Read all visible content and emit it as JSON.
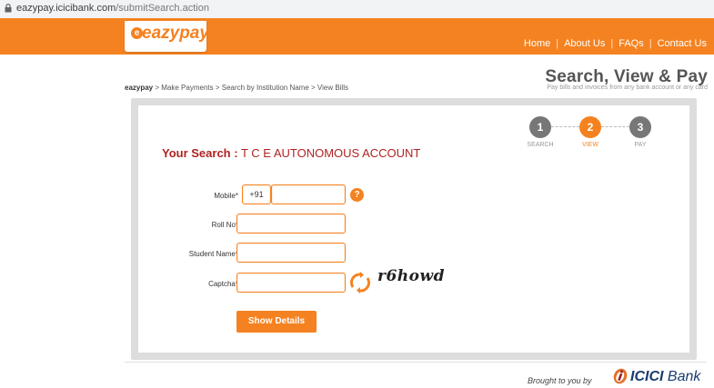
{
  "browser": {
    "host": "eazypay.icicibank.com",
    "path": "/submitSearch.action"
  },
  "header": {
    "logo_text": "eazypay",
    "nav": [
      "Home",
      "About Us",
      "FAQs",
      "Contact Us"
    ]
  },
  "breadcrumb": {
    "root": "eazypay",
    "trail": " > Make Payments > Search by Institution Name > View Bills"
  },
  "page": {
    "title": "Search, View & Pay",
    "subtitle": "Pay bills and invoices from any bank account or any card"
  },
  "steps": [
    {
      "num": "1",
      "label": "SEARCH",
      "active": false
    },
    {
      "num": "2",
      "label": "VIEW",
      "active": true
    },
    {
      "num": "3",
      "label": "PAY",
      "active": false
    }
  ],
  "search": {
    "label": "Your Search :",
    "value": " T C E AUTONOMOUS ACCOUNT"
  },
  "form": {
    "mobile_label": "Mobile*",
    "mobile_code": "+91",
    "mobile_value": "",
    "help_symbol": "?",
    "roll_label": "Roll No*",
    "roll_value": "",
    "name_label": "Student Name*",
    "name_value": "",
    "captcha_label": "Captcha*",
    "captcha_value": "",
    "captcha_text": "r6howd",
    "submit_label": "Show Details"
  },
  "footer": {
    "brought_by": "Brought to you by",
    "bank_name": "ICICI",
    "bank_suffix": " Bank"
  },
  "colors": {
    "accent": "#f58220",
    "search_text": "#b22222",
    "bank_blue": "#1a3c6e"
  },
  "icons": [
    "lock-icon",
    "help-icon",
    "refresh-captcha-icon",
    "icici-logo-icon"
  ]
}
